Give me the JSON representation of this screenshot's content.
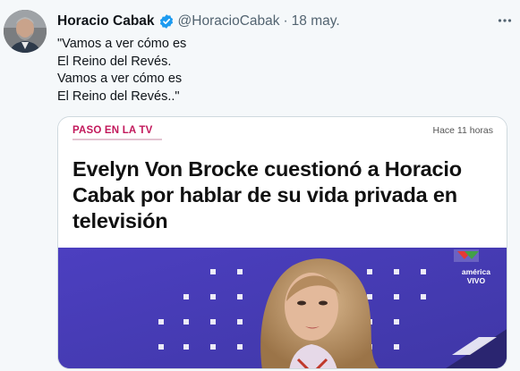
{
  "tweet": {
    "display_name": "Horacio Cabak",
    "handle": "@HoracioCabak",
    "separator": "·",
    "date": "18 may.",
    "more_icon": "more-horizontal-icon",
    "text_lines": [
      "\"Vamos a ver cómo es",
      "El Reino del Revés.",
      "Vamos a ver cómo es",
      "El Reino del Revés..\""
    ]
  },
  "card": {
    "section": "PASO EN LA TV",
    "time": "Hace 11 horas",
    "headline_lines": [
      "Evelyn Von Brocke cuestionó a Horacio",
      "Cabak por hablar de su vida privada en",
      "televisión"
    ],
    "image": {
      "channel_text": "américa",
      "live_text": "VIVO"
    }
  },
  "colors": {
    "section": "#c2185b",
    "verified": "#1d9bf0",
    "tv_background": "#4a40b4"
  }
}
